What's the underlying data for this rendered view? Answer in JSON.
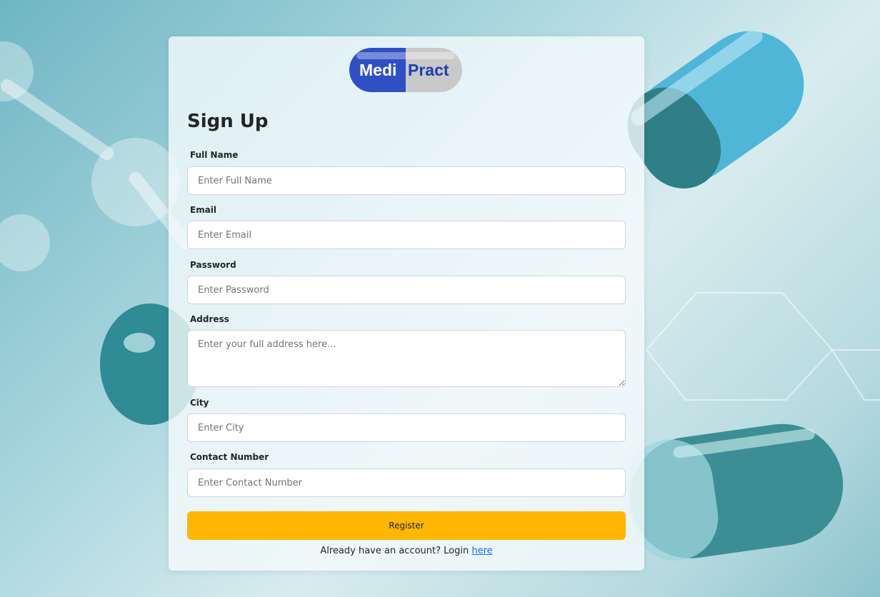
{
  "brand": {
    "name_left": "Medi",
    "name_right": "Pract",
    "colors": {
      "left": "#2f4fc4",
      "right": "#c9c9c9",
      "text_right": "#1d3fb0"
    }
  },
  "form": {
    "title": "Sign Up",
    "fields": [
      {
        "label": "Full Name",
        "placeholder": "Enter Full Name"
      },
      {
        "label": "Email",
        "placeholder": "Enter Email"
      },
      {
        "label": "Password",
        "placeholder": "Enter Password"
      },
      {
        "label": "Address",
        "placeholder": "Enter your full address here..."
      },
      {
        "label": "City",
        "placeholder": "Enter City"
      },
      {
        "label": "Contact Number",
        "placeholder": "Enter Contact Number"
      }
    ],
    "submit_label": "Register",
    "login_prompt": "Already have an account? Login",
    "login_link": "here"
  },
  "colors": {
    "accent": "#ffb703",
    "link": "#0d6efd"
  }
}
